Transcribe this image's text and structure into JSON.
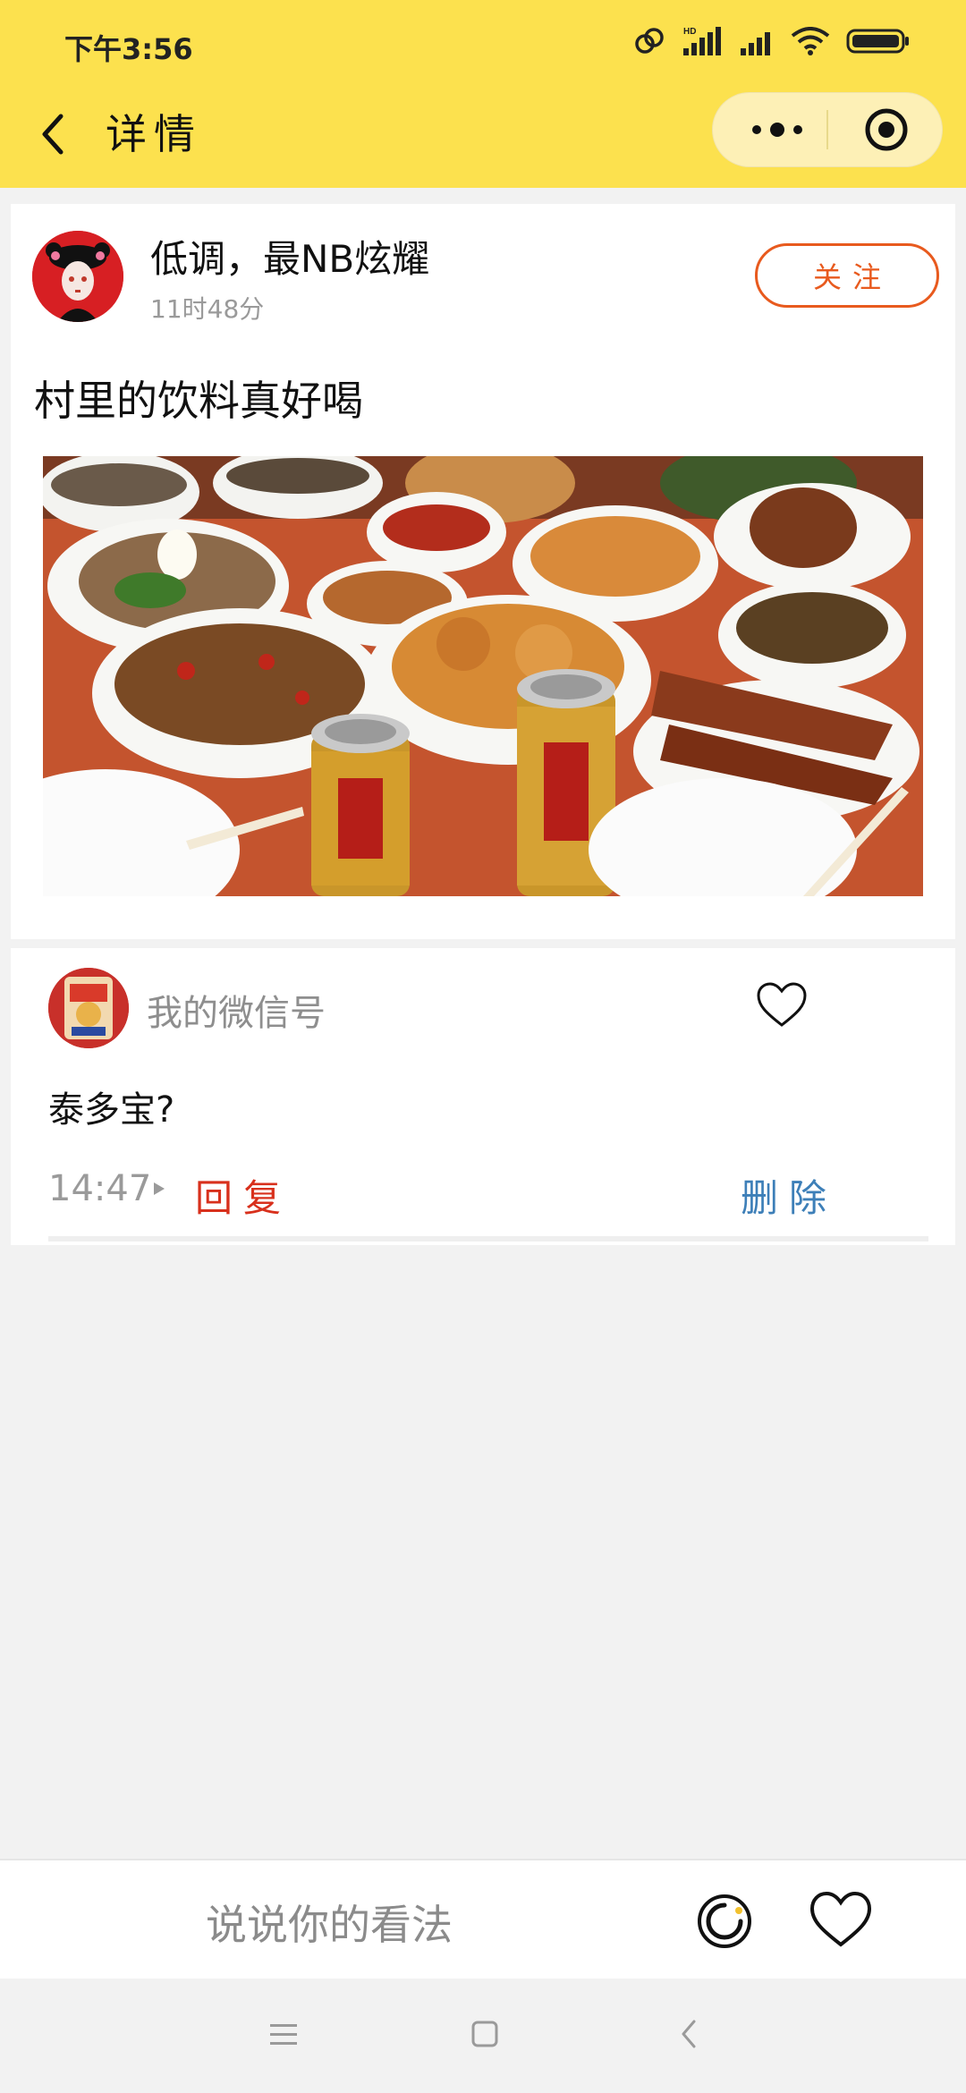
{
  "status": {
    "time": "下午3:56",
    "network_badge": "HD"
  },
  "nav": {
    "title": "详情"
  },
  "post": {
    "username": "低调，最NB炫耀",
    "time_ago": "11时48分",
    "follow_label": "关注",
    "text": "村里的饮料真好喝"
  },
  "comment": {
    "author": "我的微信号",
    "text": "泰多宝?",
    "time": "14:47",
    "reply_label": "回复",
    "delete_label": "删除"
  },
  "input": {
    "placeholder": "说说你的看法"
  },
  "colors": {
    "brand_yellow": "#fce14e",
    "capsule_bg": "#fdf0b6",
    "follow_orange": "#e85a1e",
    "reply_red": "#d8301c",
    "delete_blue": "#3d7fb8",
    "muted_gray": "#9a9a9a"
  },
  "icons": {
    "back": "chevron-left-icon",
    "more": "more-dots-icon",
    "close_miniprogram": "target-circle-icon",
    "comment_like": "heart-outline-icon",
    "share": "share-ring-icon",
    "post_like": "heart-outline-icon"
  }
}
